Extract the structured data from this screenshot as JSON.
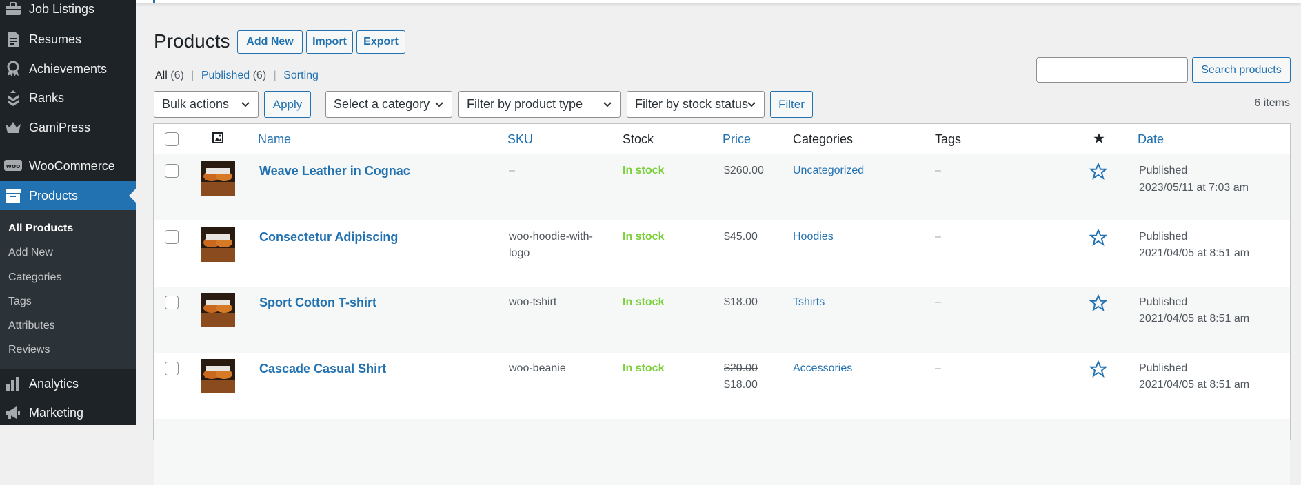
{
  "sidebar": {
    "menu": [
      {
        "label": "Job Listings",
        "icon": "briefcase-icon"
      },
      {
        "label": "Resumes",
        "icon": "document-icon"
      },
      {
        "label": "Achievements",
        "icon": "award-icon"
      },
      {
        "label": "Ranks",
        "icon": "ranks-icon"
      },
      {
        "label": "GamiPress",
        "icon": "crown-icon"
      },
      {
        "label": "WooCommerce",
        "icon": "woo-icon"
      },
      {
        "label": "Products",
        "icon": "archive-icon"
      },
      {
        "label": "Analytics",
        "icon": "bar-chart-icon"
      },
      {
        "label": "Marketing",
        "icon": "megaphone-icon"
      }
    ],
    "woo_badge": "woo",
    "submenu": [
      "All Products",
      "Add New",
      "Categories",
      "Tags",
      "Attributes",
      "Reviews"
    ]
  },
  "header": {
    "title": "Products",
    "add_new": "Add New",
    "import": "Import",
    "export": "Export"
  },
  "views": {
    "all_label": "All",
    "all_count": "(6)",
    "sep": "|",
    "published_label": "Published",
    "published_count": "(6)",
    "sorting_label": "Sorting"
  },
  "search": {
    "value": "",
    "button": "Search products"
  },
  "tablenav": {
    "bulk_actions": "Bulk actions",
    "apply": "Apply",
    "category": "Select a category",
    "product_type": "Filter by product type",
    "stock_status": "Filter by stock status",
    "filter": "Filter",
    "items_count": "6 items"
  },
  "table": {
    "columns": {
      "name": "Name",
      "sku": "SKU",
      "stock": "Stock",
      "price": "Price",
      "categories": "Categories",
      "tags": "Tags",
      "date": "Date"
    },
    "rows": [
      {
        "name": "Weave Leather in Cognac",
        "sku": "–",
        "sku2": "",
        "stock": "In stock",
        "price": "$260.00",
        "sale_price": "",
        "category": "Uncategorized",
        "tags": "–",
        "status": "Published",
        "date": "2023/05/11 at 7:03 am"
      },
      {
        "name": "Consectetur Adipiscing",
        "sku": "woo-hoodie-with-",
        "sku2": "logo",
        "stock": "In stock",
        "price": "$45.00",
        "sale_price": "",
        "category": "Hoodies",
        "tags": "–",
        "status": "Published",
        "date": "2021/04/05 at 8:51 am"
      },
      {
        "name": "Sport Cotton T-shirt",
        "sku": "woo-tshirt",
        "sku2": "",
        "stock": "In stock",
        "price": "$18.00",
        "sale_price": "",
        "category": "Tshirts",
        "tags": "–",
        "status": "Published",
        "date": "2021/04/05 at 8:51 am"
      },
      {
        "name": "Cascade Casual Shirt",
        "sku": "woo-beanie",
        "sku2": "",
        "stock": "In stock",
        "price": "$20.00",
        "sale_price": "$18.00",
        "category": "Accessories",
        "tags": "–",
        "status": "Published",
        "date": "2021/04/05 at 8:51 am"
      }
    ]
  },
  "colors": {
    "sidebar_bg": "#1d2327",
    "accent": "#2271b1",
    "in_stock": "#7ad03a"
  }
}
